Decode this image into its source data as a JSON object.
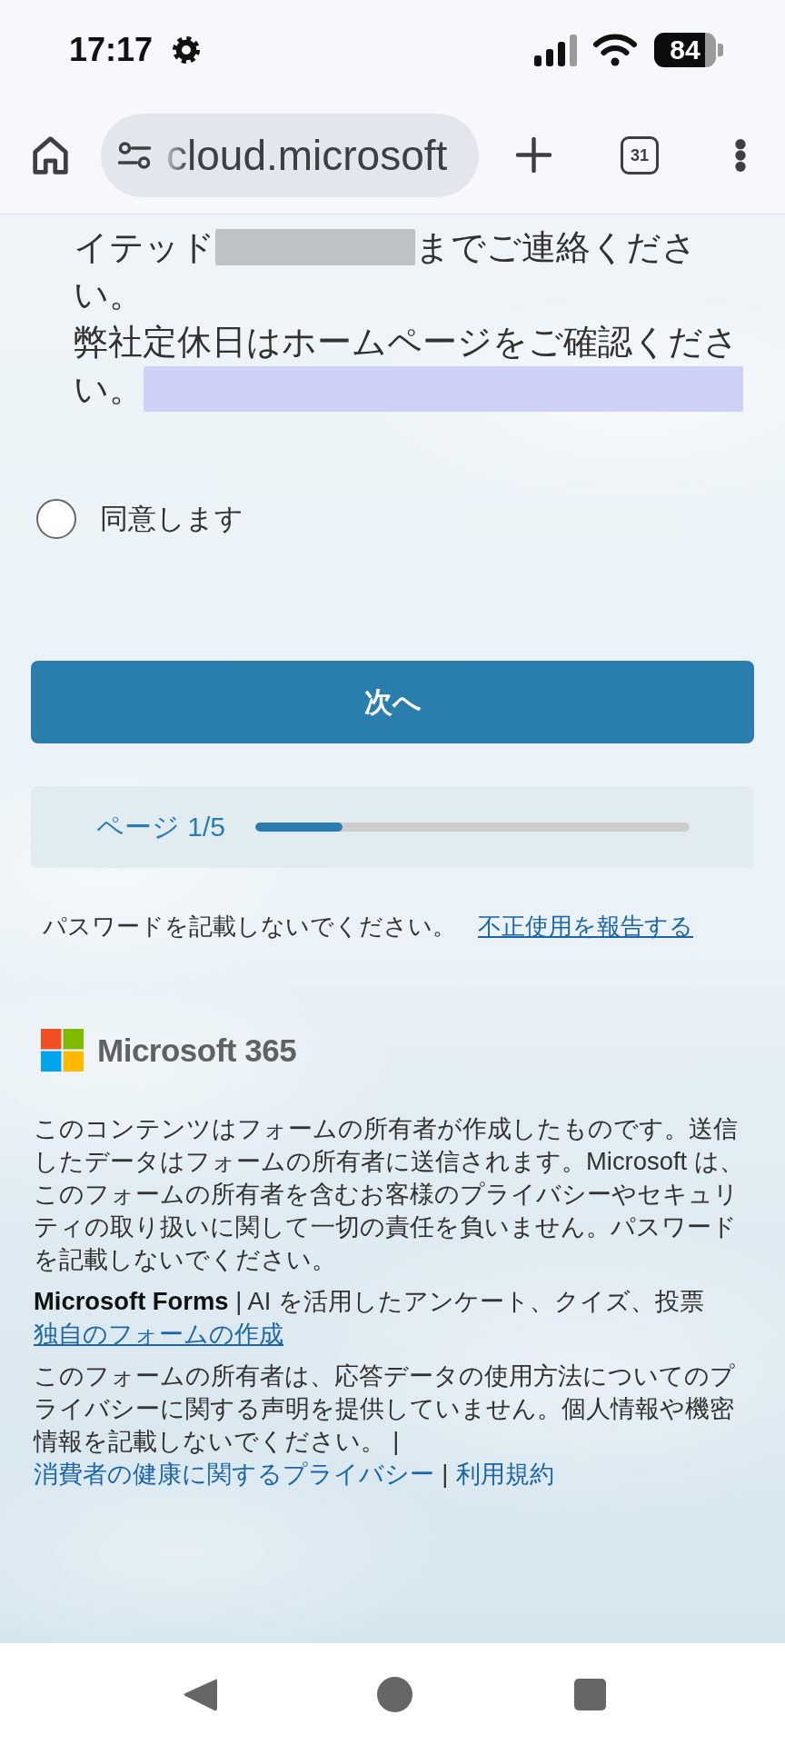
{
  "status_bar": {
    "time": "17:17",
    "battery": "84"
  },
  "browser_toolbar": {
    "url": "cloud.microsoft",
    "tab_count": "31"
  },
  "notice_lines": [
    {
      "parts": [
        {
          "kind": "text",
          "text": "イテッド"
        },
        {
          "kind": "redaction",
          "color": "#bfc2c5"
        },
        {
          "kind": "text",
          "text": "までご連絡くださ"
        }
      ]
    },
    {
      "parts": [
        {
          "kind": "text",
          "text": "い。"
        }
      ]
    },
    {
      "parts": [
        {
          "kind": "text",
          "text": "弊社定休日はホームページをご確認くださ"
        }
      ]
    },
    {
      "parts": [
        {
          "kind": "text",
          "text": "い。"
        },
        {
          "kind": "redaction",
          "color": "#cdd1f5"
        }
      ]
    }
  ],
  "consent": {
    "label": "同意します",
    "selected": false
  },
  "next_button": {
    "label": "次へ"
  },
  "progress": {
    "label": "ページ 1/5",
    "level": 0.2
  },
  "password_warning": {
    "text": "パスワードを記載しないでください。",
    "link": "不正使用を報告する"
  },
  "footer": {
    "brand": "Microsoft 365",
    "paragraphs": [
      {
        "parts": [
          {
            "kind": "text",
            "text": "このコンテンツはフォームの所有者が作成したものです。送信したデータはフォームの所有者に送信されます。Microsoft は、このフォームの所有者を含むお客様のプライバシーやセキュリティの取り扱いに関して一切の責任を負いません。パスワードを記載しないでください。"
          }
        ]
      },
      {
        "parts": [
          {
            "kind": "text",
            "text": "**Microsoft Forms** | AI を活用したアンケート、クイズ、投票"
          },
          {
            "kind": "link",
            "text": "独自のフォームの作成",
            "underlined": true
          }
        ]
      },
      {
        "parts": [
          {
            "kind": "text",
            "text": "このフォームの所有者は、応答データの使用方法についてのプライバシーに関する声明を提供していません。個人情報や機密情報を記載しないでください。"
          },
          {
            "kind": "separator",
            "text": "|"
          },
          {
            "kind": "link",
            "text": "消費者の健康に関するプライバシー",
            "underlined": false
          },
          {
            "kind": "separator",
            "text": "|"
          },
          {
            "kind": "link",
            "text": "利用規約",
            "underlined": false
          }
        ]
      }
    ]
  }
}
